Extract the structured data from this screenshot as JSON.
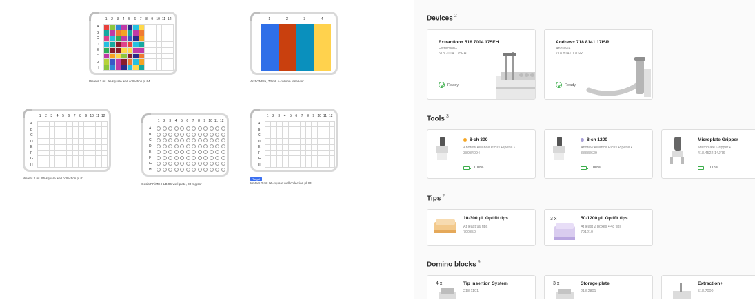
{
  "deck": {
    "plates": [
      {
        "id": "p1",
        "caption": "Waters 2 mL 96-square well collection pl #4",
        "type": "colored-96"
      },
      {
        "id": "p2",
        "caption": "ArcticWhite, 73 mL 4-column reservoir",
        "type": "reservoir-4",
        "columns": [
          "1",
          "2",
          "3",
          "4"
        ]
      },
      {
        "id": "p3",
        "caption": "Waters 2 mL 96-square well collection pl #1",
        "type": "square-96"
      },
      {
        "id": "p4",
        "caption": "Oasis PRiME HLB 96-well plate, 30 mg sor",
        "type": "round-96"
      },
      {
        "id": "p5",
        "caption": "Waters 2 mL 96-square well collection pl #3",
        "type": "square-96",
        "badge": "Target"
      }
    ],
    "col_labels": [
      "1",
      "2",
      "3",
      "4",
      "5",
      "6",
      "7",
      "8",
      "9",
      "10",
      "11",
      "12"
    ],
    "row_labels": [
      "A",
      "B",
      "C",
      "D",
      "E",
      "F",
      "G",
      "H"
    ],
    "well_palette": [
      "#e8403c",
      "#f6a323",
      "#ffd84a",
      "#8dc63f",
      "#2fae5a",
      "#16a9a0",
      "#2e88d8",
      "#3a57c7",
      "#7a46c2",
      "#c03aa6",
      "#e0418a",
      "#8a1c2b",
      "#2a2a8a",
      "#f07b32",
      "#b6d23a",
      "#25c0e0"
    ],
    "reservoir_colors": [
      "#2f6fe8",
      "#c9400e",
      "#0a90bd",
      "#ffd24d"
    ]
  },
  "panel": {
    "devices": {
      "title": "Devices",
      "count": "2",
      "items": [
        {
          "name": "Extraction+ 518.7004.175EH",
          "sub1": "Extraction+",
          "sub2": "518.7004.175EH",
          "status": "Ready"
        },
        {
          "name": "Andrew+ 718.8141.17ISR",
          "sub1": "Andrew+",
          "sub2": "718.8141.17ISR",
          "status": "Ready"
        }
      ]
    },
    "tools": {
      "title": "Tools",
      "count": "3",
      "items": [
        {
          "name": "8-ch 300",
          "sub1": "Andrew Alliance Picus Pipette •",
          "sub2": "38984094",
          "battery": "100%",
          "dot": "#f5a623"
        },
        {
          "name": "8-ch 1200",
          "sub1": "Andrew Alliance Picus Pipette •",
          "sub2": "38388639",
          "battery": "100%",
          "dot": "#a9a0d8"
        },
        {
          "name": "Microplate Gripper",
          "sub1": "Microplate Gripper •",
          "sub2": "418.4522.14JR6",
          "battery": "100%"
        }
      ]
    },
    "tips": {
      "title": "Tips",
      "count": "2",
      "items": [
        {
          "name": "10-300 µL Optifit tips",
          "sub1": "At least 96 tips",
          "sub2": "790350"
        },
        {
          "name": "50-1200 µL Optifit tips",
          "sub1": "At least 2 boxes • 48 tips",
          "sub2": "791210",
          "qty": "3 x"
        }
      ]
    },
    "domino": {
      "title": "Domino blocks",
      "count": "9",
      "items": [
        {
          "name": "Tip Insertion System",
          "sub1": "218.1101",
          "qty": "4 x"
        },
        {
          "name": "Storage plate",
          "sub1": "218.2801",
          "qty": "3 x"
        },
        {
          "name": "Extraction+",
          "sub1": "518.7000"
        }
      ]
    }
  }
}
